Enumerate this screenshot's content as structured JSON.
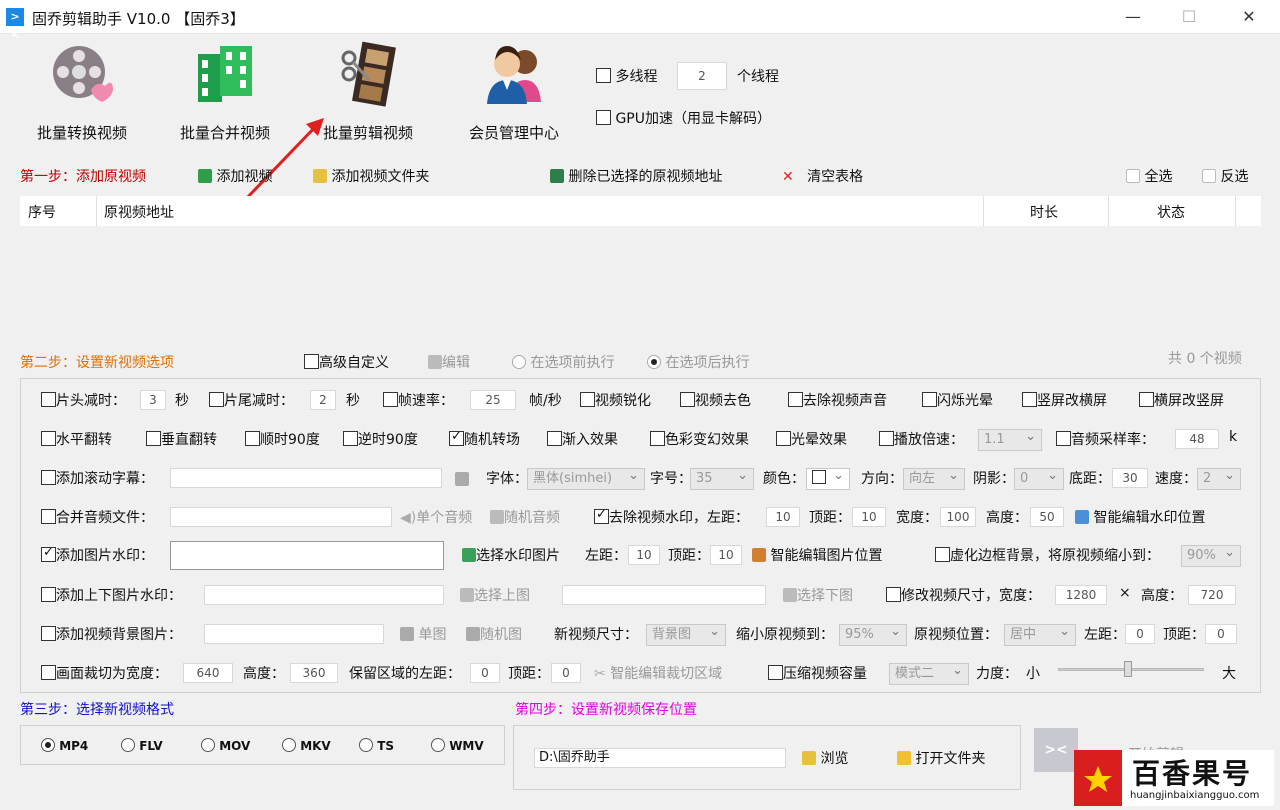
{
  "window": {
    "title": "固乔剪辑助手 V10.0 【固乔3】",
    "minimize": "—",
    "maximize": "☐",
    "close": "✕"
  },
  "toolbar": {
    "convert": "批量转换视频",
    "merge": "批量合并视频",
    "edit": "批量剪辑视频",
    "member": "会员管理中心",
    "multithread": "多线程",
    "threads": "2",
    "threads_unit": "个线程",
    "gpu": "GPU加速（用显卡解码）"
  },
  "step1": {
    "label": "第一步：添加原视频",
    "add_video": "添加视频",
    "add_folder": "添加视频文件夹",
    "delete_selected": "删除已选择的原视频地址",
    "clear": "清空表格",
    "select_all": "全选",
    "invert": "反选",
    "columns": [
      "序号",
      "原视频地址",
      "时长",
      "状态"
    ]
  },
  "step2": {
    "label": "第二步：设置新视频选项",
    "advanced": "高级自定义",
    "edit": "编辑",
    "before": "在选项前执行",
    "after": "在选项后执行",
    "count": "共 0 个视频"
  },
  "opts": {
    "head_cut": "片头减时：",
    "head_val": "3",
    "sec1": "秒",
    "tail_cut": "片尾减时：",
    "tail_val": "2",
    "sec2": "秒",
    "fps": "帧速率：",
    "fps_val": "25",
    "fps_unit": "帧/秒",
    "sharpen": "视频锐化",
    "decolor": "视频去色",
    "mute": "去除视频声音",
    "flash": "闪烁光晕",
    "v2h": "竖屏改横屏",
    "h2v": "横屏改竖屏",
    "hflip": "水平翻转",
    "vflip": "垂直翻转",
    "cw90": "顺时90度",
    "ccw90": "逆时90度",
    "rand_trans": "随机转场",
    "fade": "渐入效果",
    "color_fx": "色彩变幻效果",
    "halo": "光晕效果",
    "speed": "播放倍速：",
    "speed_val": "1.1",
    "sample": "音频采样率：",
    "sample_val": "48",
    "sample_unit": "k",
    "subtitle": "添加滚动字幕：",
    "font": "字体：",
    "font_val": "黑体(simhei)",
    "size": "字号：",
    "size_val": "35",
    "color": "颜色：",
    "dir": "方向：",
    "dir_val": "向左",
    "shadow": "阴影：",
    "shadow_val": "0",
    "bottom": "底距：",
    "bottom_val": "30",
    "spd": "速度：",
    "spd_val": "2",
    "merge_audio": "合并音频文件：",
    "single_audio": "单个音频",
    "rand_audio": "随机音频",
    "rm_watermark": "去除视频水印，左距：",
    "wm_left": "10",
    "wm_top_l": "顶距：",
    "wm_top": "10",
    "wm_w_l": "宽度：",
    "wm_w": "100",
    "wm_h_l": "高度：",
    "wm_h": "50",
    "smart_wm": "智能编辑水印位置",
    "img_wm": "添加图片水印：",
    "choose_wm": "选择水印图片",
    "iw_left_l": "左距：",
    "iw_left": "10",
    "iw_top_l": "顶距：",
    "iw_top": "10",
    "smart_img": "智能编辑图片位置",
    "blur_bg": "虚化边框背景，将原视频缩小到：",
    "blur_val": "90%",
    "tb_wm": "添加上下图片水印：",
    "choose_top": "选择上图",
    "choose_bottom": "选择下图",
    "resize": "修改视频尺寸，宽度：",
    "resize_w": "1280",
    "times": "×",
    "resize_h_l": "高度：",
    "resize_h": "720",
    "bg_img": "添加视频背景图片：",
    "single_img": "单图",
    "rand_img": "随机图",
    "new_size": "新视频尺寸：",
    "new_size_val": "背景图",
    "shrink": "缩小原视频到：",
    "shrink_val": "95%",
    "orig_pos": "原视频位置：",
    "orig_pos_val": "居中",
    "bl_l": "左距：",
    "bl": "0",
    "bt_l": "顶距：",
    "bt": "0",
    "crop": "画面裁切为宽度：",
    "crop_w": "640",
    "crop_h_l": "高度：",
    "crop_h": "360",
    "keep_left": "保留区域的左距：",
    "keep_left_val": "0",
    "keep_top_l": "顶距：",
    "keep_top": "0",
    "smart_crop": "智能编辑裁切区域",
    "compress": "压缩视频容量",
    "mode": "模式二",
    "force": "力度：",
    "small": "小",
    "big": "大"
  },
  "step3": {
    "label": "第三步：选择新视频格式",
    "formats": [
      "MP4",
      "FLV",
      "MOV",
      "MKV",
      "TS",
      "WMV"
    ]
  },
  "step4": {
    "label": "第四步：设置新视频保存位置",
    "path": "D:\\固乔助手",
    "browse": "浏览",
    "open_folder": "打开文件夹",
    "start": "开始剪辑"
  },
  "watermark": {
    "brand": "百香果号",
    "url": "huangjinbaixiangguo.com"
  },
  "colors": {
    "step1": "#c00000",
    "step2": "#e07000",
    "step3": "#1010d0",
    "step4": "#e000e0",
    "arrow": "#e02020"
  }
}
